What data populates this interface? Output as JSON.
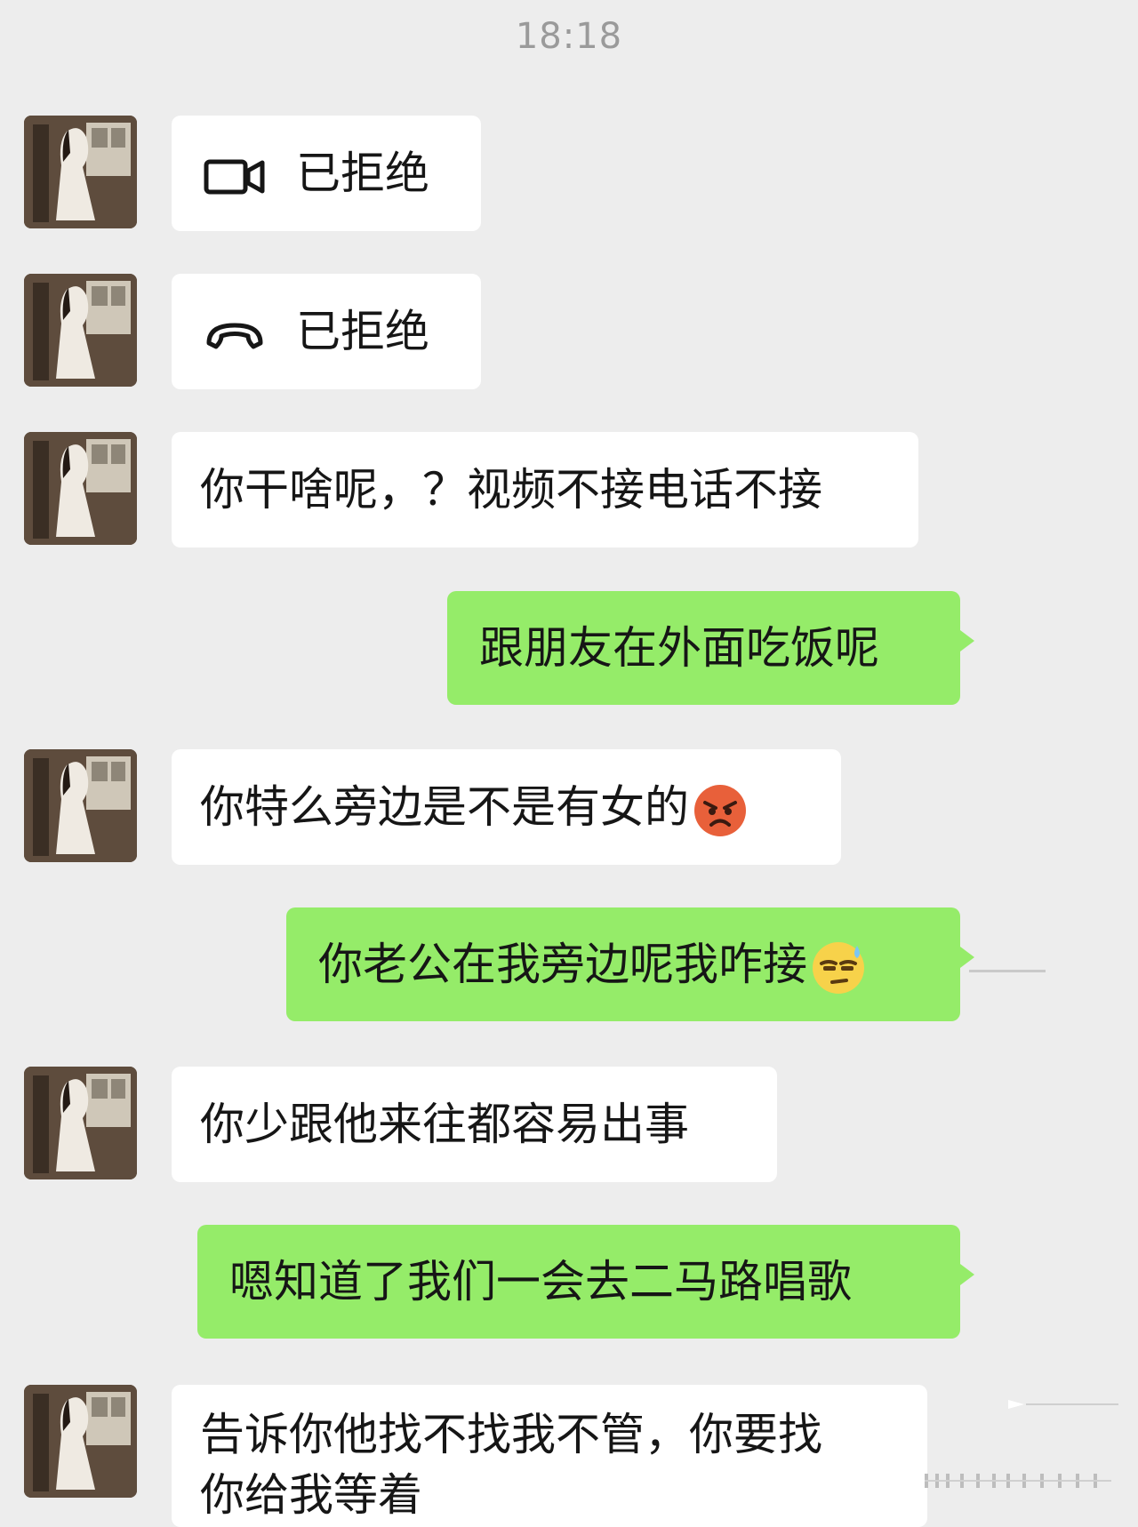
{
  "status": {
    "time": "18:18"
  },
  "messages": [
    {
      "side": "in",
      "type": "video-call",
      "text": "已拒绝",
      "icon": "video-camera-icon"
    },
    {
      "side": "in",
      "type": "voice-call",
      "text": "已拒绝",
      "icon": "phone-handset-icon"
    },
    {
      "side": "in",
      "type": "text",
      "text": "你干啥呢，？视频不接电话不接"
    },
    {
      "side": "out",
      "type": "text",
      "text": "跟朋友在外面吃饭呢"
    },
    {
      "side": "in",
      "type": "text",
      "text": "你特么旁边是不是有女的",
      "emoji": "angry-face-icon"
    },
    {
      "side": "out",
      "type": "text",
      "text": "你老公在我旁边呢我咋接",
      "emoji": "sweat-face-icon"
    },
    {
      "side": "in",
      "type": "text",
      "text": "你少跟他来往都容易出事"
    },
    {
      "side": "out",
      "type": "text",
      "text": "嗯知道了我们一会去二马路唱歌"
    },
    {
      "side": "in",
      "type": "text",
      "lines": [
        "告诉你他找不找我不管，你要找",
        "你给我等着"
      ]
    }
  ],
  "colors": {
    "background": "#ededed",
    "incoming_bubble": "#ffffff",
    "outgoing_bubble": "#95ec69",
    "timestamp": "#9a9a9a"
  }
}
